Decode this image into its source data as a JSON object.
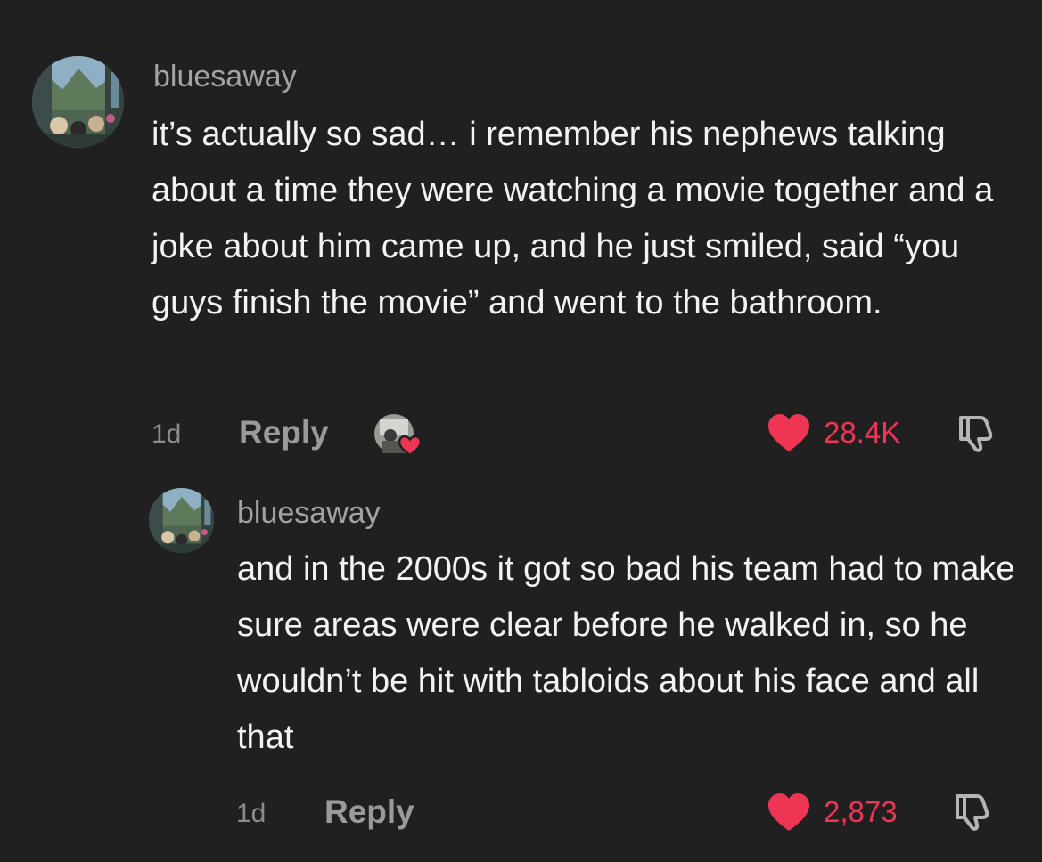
{
  "comments": [
    {
      "username": "bluesaway",
      "text": "it’s actually so sad… i remember his nephews talking about a time they were watching a movie together and a joke about him came up, and he just smiled, said “you guys finish the movie” and went to the bathroom.",
      "time": "1d",
      "reply_label": "Reply",
      "likes": "28.4K",
      "liked_by_creator": true
    },
    {
      "username": "bluesaway",
      "text": "and in the 2000s it got so bad his team had to make sure areas were clear before he walked in, so he wouldn’t be hit with tabloids about his face and all that",
      "time": "1d",
      "reply_label": "Reply",
      "likes": "2,873"
    }
  ],
  "icons": {
    "like": "heart-icon",
    "dislike": "thumbs-down-icon",
    "creator_liked": "creator-liked-avatar-icon"
  },
  "colors": {
    "background": "#202021",
    "like_red": "#ee3554",
    "username_gray": "#a3a3a5",
    "text_white": "#f3f3f3"
  }
}
